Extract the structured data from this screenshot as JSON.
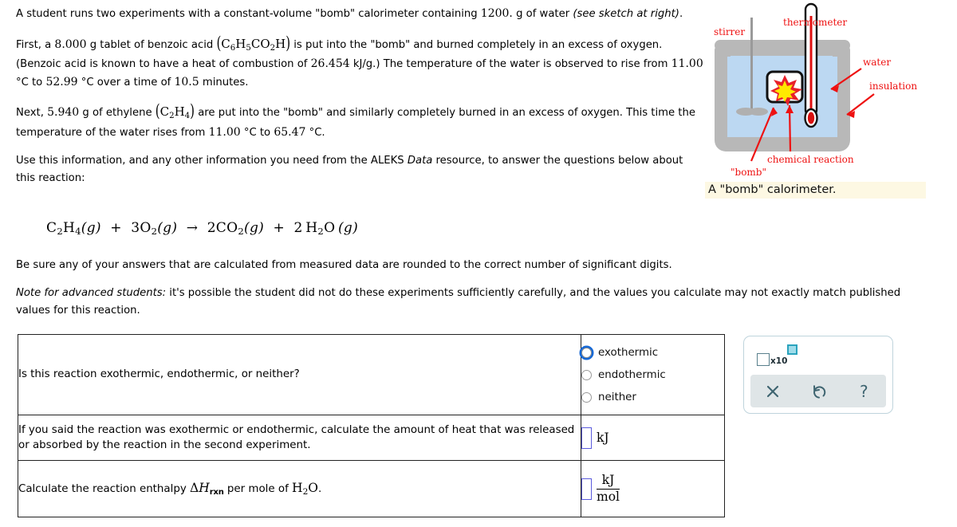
{
  "problem": {
    "paragraphs": [
      {
        "id": "intro",
        "parts": [
          {
            "t": "text",
            "v": "A student runs two experiments with a constant-volume \"bomb\" calorimeter containing "
          },
          {
            "t": "num",
            "v": "1200."
          },
          {
            "t": "text",
            "v": " g of water "
          },
          {
            "t": "ital",
            "v": "(see sketch at right)"
          },
          {
            "t": "text",
            "v": "."
          }
        ]
      }
    ],
    "intro_text_a": "A student runs two experiments with a constant-volume \"bomb\" calorimeter containing ",
    "water_mass": "1200.",
    "intro_text_b": " g of water ",
    "intro_italic": "(see sketch at right)",
    "intro_text_c": ".",
    "first_text_a": "First, a ",
    "benzoic_mass": "8.000",
    "first_text_b": " g tablet of benzoic acid ",
    "benzoic_formula": "C6H5CO2H",
    "first_text_c": " is put into the \"bomb\" and burned completely in an excess of oxygen. (Benzoic acid is known to have a heat of combustion of ",
    "benzoic_heat": "26.454",
    "first_text_d": " kJ/g.) The temperature of the water is observed to rise from ",
    "exp1_t_initial": "11.00",
    "first_text_e": " °C to ",
    "exp1_t_final": "52.99",
    "first_text_f": " °C over a time of ",
    "exp1_time": "10.5",
    "first_text_g": " minutes.",
    "next_text_a": "Next, ",
    "ethylene_mass": "5.940",
    "next_text_b": " g of ethylene ",
    "ethylene_formula": "C2H4",
    "next_text_c": " are put into the \"bomb\" and similarly completely burned in an excess of oxygen. This time the temperature of the water rises from ",
    "exp2_t_initial": "11.00",
    "next_text_d": " °C to ",
    "exp2_t_final": "65.47",
    "next_text_e": " °C.",
    "use_info_a": "Use this information, and any other information you need from the ALEKS ",
    "use_info_italic": "Data",
    "use_info_b": " resource, to answer the questions below about this reaction:",
    "sigfig_note": "Be sure any of your answers that are calculated from measured data are rounded to the correct number of significant digits.",
    "advanced_note_label": "Note for advanced students:",
    "advanced_note_body": " it's possible the student did not do these experiments sufficiently carefully, and the values you calculate may not exactly match published values for this reaction."
  },
  "equation": {
    "full": "C2H4(g) + 3O2(g) → 2CO2(g) + 2H2O(g)",
    "reactant1": "C",
    "reactant1_sub1": "2",
    "reactant1_el2": "H",
    "reactant1_sub2": "4",
    "state_g": "g",
    "plus": "+",
    "o2_coef": "3",
    "o2_el": "O",
    "o2_sub": "2",
    "arrow": "→",
    "co2_coef": "2",
    "co2_el": "CO",
    "co2_sub": "2",
    "h2o_coef": "2",
    "h2o_el1": "H",
    "h2o_sub": "2",
    "h2o_el2": "O"
  },
  "figure": {
    "caption": "A \"bomb\" calorimeter.",
    "labels": {
      "stirrer": "stirrer",
      "thermometer": "thermometer",
      "water": "water",
      "insulation": "insulation",
      "bomb": "\"bomb\"",
      "chemical_reaction": "chemical reaction"
    },
    "colors": {
      "body": "#b8b8b8",
      "water": "#bcd8f2",
      "label_red": "#ee1111",
      "star_outer": "#e8202a",
      "star_inner": "#ffe800",
      "caption_bg": "#fdf8e3"
    }
  },
  "answer_table": {
    "rows": [
      {
        "question": "Is this reaction exothermic, endothermic, or neither?",
        "answer_type": "radio",
        "options": [
          {
            "label": "exothermic",
            "focused": true,
            "selected": false
          },
          {
            "label": "endothermic",
            "focused": false,
            "selected": false
          },
          {
            "label": "neither",
            "focused": false,
            "selected": false
          }
        ]
      },
      {
        "question": "If you said the reaction was exothermic or endothermic, calculate the amount of heat that was released or absorbed by the reaction in the second experiment.",
        "answer_type": "input-unit",
        "value": "",
        "unit": "kJ"
      },
      {
        "question_a": "Calculate the reaction enthalpy ΔH",
        "question_sub": "rxn",
        "question_b": " per mole of H2O.",
        "answer_type": "input-fraction",
        "value": "",
        "unit_numerator": "kJ",
        "unit_denominator": "mol"
      }
    ]
  },
  "tool_panel": {
    "sci_notation_label": "x10",
    "buttons": [
      {
        "name": "clear",
        "glyph": "✕"
      },
      {
        "name": "undo",
        "glyph": "↺"
      },
      {
        "name": "help",
        "glyph": "?"
      }
    ],
    "accent": "#2aa3bd",
    "bar_bg": "#dfe5e7"
  }
}
